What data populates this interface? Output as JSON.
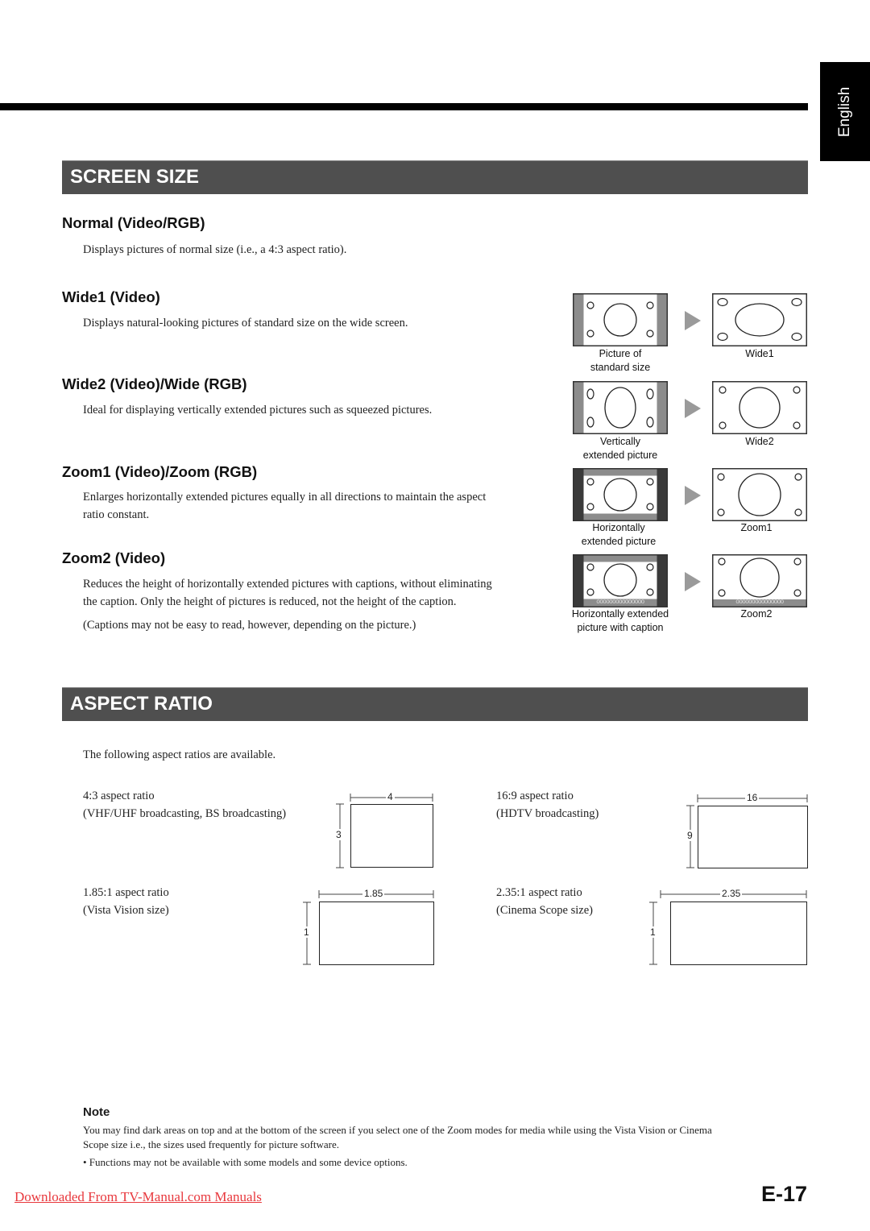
{
  "language_tab": "English",
  "screen_size": {
    "title": "SCREEN SIZE",
    "modes": [
      {
        "heading": "Normal (Video/RGB)",
        "text": [
          "Displays pictures of normal size (i.e., a 4:3 aspect ratio)."
        ]
      },
      {
        "heading": "Wide1 (Video)",
        "text": [
          "Displays natural-looking pictures of standard size on the wide screen."
        ]
      },
      {
        "heading": "Wide2 (Video)/Wide (RGB)",
        "text": [
          "Ideal for displaying vertically extended pictures such as squeezed pictures."
        ]
      },
      {
        "heading": "Zoom1 (Video)/Zoom (RGB)",
        "text": [
          "Enlarges horizontally extended pictures equally in all directions to maintain the aspect",
          "ratio constant."
        ]
      },
      {
        "heading": "Zoom2 (Video)",
        "text": [
          "Reduces the height of horizontally extended pictures with captions, without eliminating",
          "the caption.  Only the height of pictures is reduced, not the height of the caption.",
          "(Captions may not be easy to read, however, depending on the picture.)"
        ]
      }
    ],
    "diagrams": [
      {
        "source_caption": [
          "Picture of",
          "standard size"
        ],
        "result_caption": "Wide1"
      },
      {
        "source_caption": [
          "Vertically",
          "extended picture"
        ],
        "result_caption": "Wide2"
      },
      {
        "source_caption": [
          "Horizontally",
          "extended picture"
        ],
        "result_caption": "Zoom1"
      },
      {
        "source_caption": [
          "Horizontally extended",
          "picture with caption"
        ],
        "result_caption": "Zoom2"
      }
    ],
    "caption_glyphs": "ooooooooooooooo"
  },
  "aspect_ratio": {
    "title": "ASPECT RATIO",
    "intro": "The following aspect ratios are available.",
    "ratios": [
      {
        "label": "4:3 aspect ratio",
        "usage": "(VHF/UHF broadcasting, BS broadcasting)",
        "width_label": "4",
        "height_label": "3"
      },
      {
        "label": "16:9 aspect ratio",
        "usage": "(HDTV broadcasting)",
        "width_label": "16",
        "height_label": "9"
      },
      {
        "label": "1.85:1 aspect ratio",
        "usage": "(Vista Vision size)",
        "width_label": "1.85",
        "height_label": "1"
      },
      {
        "label": "2.35:1 aspect ratio",
        "usage": "(Cinema Scope size)",
        "width_label": "2.35",
        "height_label": "1"
      }
    ]
  },
  "note": {
    "title": "Note",
    "lines": [
      "You may find dark areas on top and at the bottom of the screen if you select one of the Zoom modes for media while using the Vista Vision or Cinema",
      "Scope size i.e., the sizes used frequently for picture software."
    ],
    "bullet": "•  Functions may not be available with some models and some device options."
  },
  "footer": {
    "link_text": "Downloaded From TV-Manual.com Manuals",
    "page_number": "E-17"
  }
}
